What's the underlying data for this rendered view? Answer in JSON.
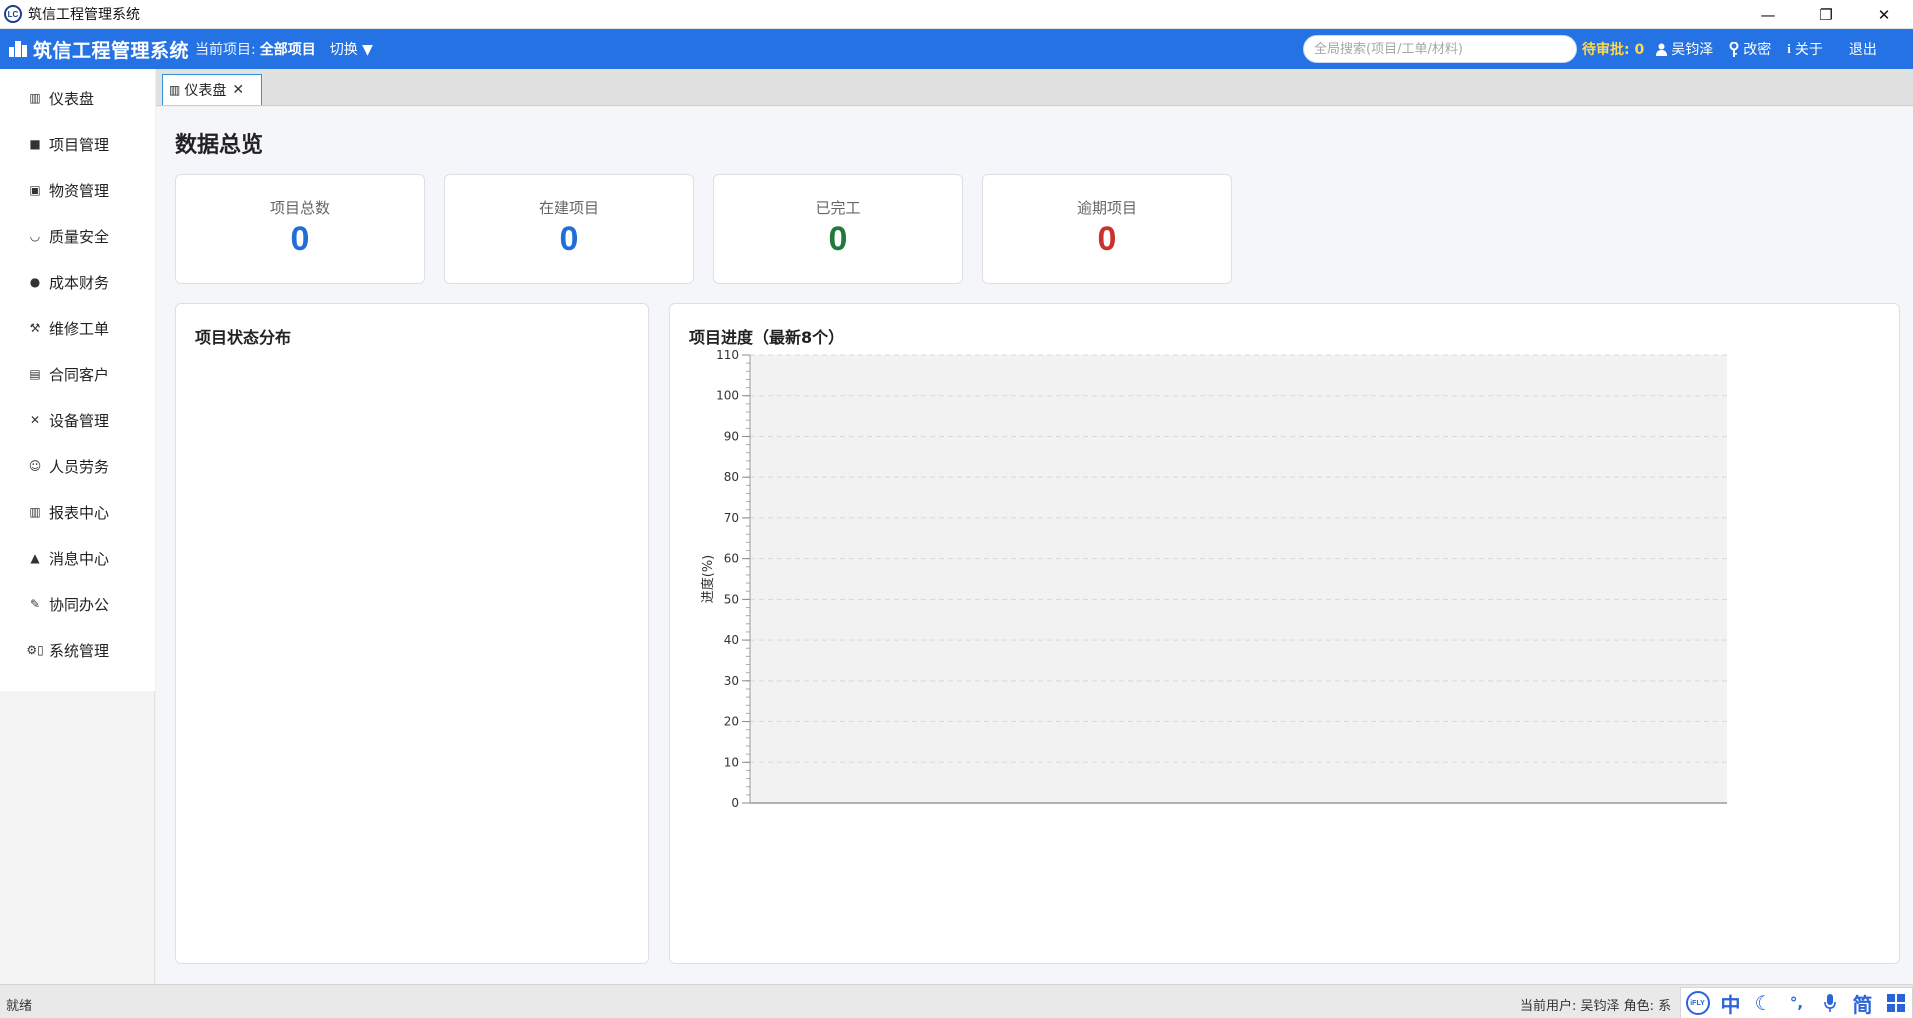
{
  "window": {
    "title": "筑信工程管理系统",
    "logo_text": "LC",
    "minimize_label": "—",
    "maximize_label": "❐",
    "close_label": "✕"
  },
  "header": {
    "app_title": "筑信工程管理系统",
    "current_project_label": "当前项目:",
    "current_project_value": "全部项目",
    "switch_label": "切换 ▼",
    "search_placeholder": "全局搜索(项目/工单/材料)",
    "pending_label": "待审批: 0",
    "user_name": "吴钧泽",
    "change_password_label": "改密",
    "about_label": "关于",
    "logout_label": "退出",
    "accent_color": "#2472e3"
  },
  "sidebar": {
    "items": [
      {
        "label": "仪表盘",
        "icon": "dashboard-icon",
        "glyph": "▥"
      },
      {
        "label": "项目管理",
        "icon": "briefcase-icon",
        "glyph": "■"
      },
      {
        "label": "物资管理",
        "icon": "package-icon",
        "glyph": "▣"
      },
      {
        "label": "质量安全",
        "icon": "shield-icon",
        "glyph": "◡"
      },
      {
        "label": "成本财务",
        "icon": "money-bag-icon",
        "glyph": "●"
      },
      {
        "label": "维修工单",
        "icon": "wrench-icon",
        "glyph": "⚒"
      },
      {
        "label": "合同客户",
        "icon": "document-icon",
        "glyph": "▤"
      },
      {
        "label": "设备管理",
        "icon": "tools-icon",
        "glyph": "✕"
      },
      {
        "label": "人员劳务",
        "icon": "worker-icon",
        "glyph": "☺"
      },
      {
        "label": "报表中心",
        "icon": "report-icon",
        "glyph": "▥"
      },
      {
        "label": "消息中心",
        "icon": "bell-icon",
        "glyph": "▲"
      },
      {
        "label": "协同办公",
        "icon": "edit-icon",
        "glyph": "✎"
      },
      {
        "label": "系统管理",
        "icon": "settings-icon",
        "glyph": "⚙▯"
      }
    ]
  },
  "tabs": [
    {
      "label": "仪表盘",
      "close": "✕"
    }
  ],
  "dashboard": {
    "title": "数据总览",
    "stats": [
      {
        "label": "项目总数",
        "value": "0",
        "color": "#1f6fd6"
      },
      {
        "label": "在建项目",
        "value": "0",
        "color": "#1f6fd6"
      },
      {
        "label": "已完工",
        "value": "0",
        "color": "#1f7a3c"
      },
      {
        "label": "逾期项目",
        "value": "0",
        "color": "#c8332f"
      }
    ],
    "status_panel_title": "项目状态分布",
    "progress_panel_title": "项目进度（最新8个）"
  },
  "chart_data": {
    "type": "bar",
    "categories": [],
    "values": [],
    "title": "",
    "xlabel": "",
    "ylabel": "进度(%)",
    "ylim": [
      0,
      110
    ],
    "yticks": [
      0,
      10,
      20,
      30,
      40,
      50,
      60,
      70,
      80,
      90,
      100,
      110
    ],
    "grid": true
  },
  "statusbar": {
    "ready": "就绪",
    "user_info": "当前用户: 吴钧泽  角色: 系",
    "ime": {
      "logo": "iFLY",
      "mode": "中",
      "moon": "☾",
      "punct": "°,",
      "mic": "🎤",
      "simp": "简",
      "grid": "▦"
    }
  }
}
